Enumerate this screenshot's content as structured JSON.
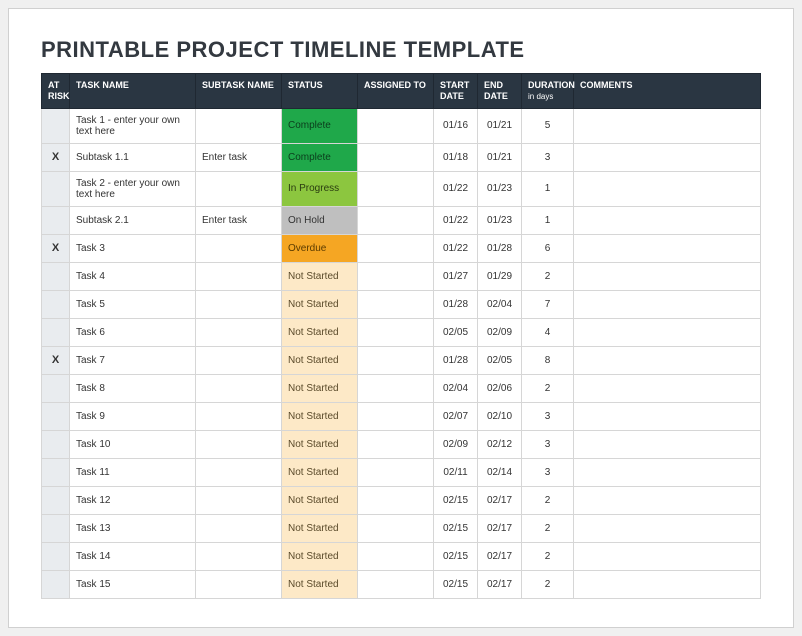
{
  "title": "PRINTABLE PROJECT TIMELINE TEMPLATE",
  "headers": {
    "at_risk": "AT RISK",
    "task_name": "TASK NAME",
    "subtask_name": "SUBTASK NAME",
    "status": "STATUS",
    "assigned_to": "ASSIGNED TO",
    "start_date": "START DATE",
    "end_date": "END DATE",
    "duration": "DURATION",
    "duration_sub": "in days",
    "comments": "COMMENTS"
  },
  "status_styles": {
    "Complete": "st-complete",
    "In Progress": "st-inprogress",
    "On Hold": "st-onhold",
    "Overdue": "st-overdue",
    "Not Started": "st-notstarted"
  },
  "rows": [
    {
      "at_risk": "",
      "task": "Task 1 - enter your own text here",
      "subtask": "",
      "status": "Complete",
      "assigned": "",
      "start": "01/16",
      "end": "01/21",
      "duration": "5",
      "comments": ""
    },
    {
      "at_risk": "X",
      "task": "Subtask 1.1",
      "subtask": "Enter task",
      "status": "Complete",
      "assigned": "",
      "start": "01/18",
      "end": "01/21",
      "duration": "3",
      "comments": ""
    },
    {
      "at_risk": "",
      "task": "Task 2 - enter your own text here",
      "subtask": "",
      "status": "In Progress",
      "assigned": "",
      "start": "01/22",
      "end": "01/23",
      "duration": "1",
      "comments": ""
    },
    {
      "at_risk": "",
      "task": "Subtask 2.1",
      "subtask": "Enter task",
      "status": "On Hold",
      "assigned": "",
      "start": "01/22",
      "end": "01/23",
      "duration": "1",
      "comments": ""
    },
    {
      "at_risk": "X",
      "task": "Task 3",
      "subtask": "",
      "status": "Overdue",
      "assigned": "",
      "start": "01/22",
      "end": "01/28",
      "duration": "6",
      "comments": ""
    },
    {
      "at_risk": "",
      "task": "Task 4",
      "subtask": "",
      "status": "Not Started",
      "assigned": "",
      "start": "01/27",
      "end": "01/29",
      "duration": "2",
      "comments": ""
    },
    {
      "at_risk": "",
      "task": "Task 5",
      "subtask": "",
      "status": "Not Started",
      "assigned": "",
      "start": "01/28",
      "end": "02/04",
      "duration": "7",
      "comments": ""
    },
    {
      "at_risk": "",
      "task": "Task 6",
      "subtask": "",
      "status": "Not Started",
      "assigned": "",
      "start": "02/05",
      "end": "02/09",
      "duration": "4",
      "comments": ""
    },
    {
      "at_risk": "X",
      "task": "Task 7",
      "subtask": "",
      "status": "Not Started",
      "assigned": "",
      "start": "01/28",
      "end": "02/05",
      "duration": "8",
      "comments": ""
    },
    {
      "at_risk": "",
      "task": "Task 8",
      "subtask": "",
      "status": "Not Started",
      "assigned": "",
      "start": "02/04",
      "end": "02/06",
      "duration": "2",
      "comments": ""
    },
    {
      "at_risk": "",
      "task": "Task 9",
      "subtask": "",
      "status": "Not Started",
      "assigned": "",
      "start": "02/07",
      "end": "02/10",
      "duration": "3",
      "comments": ""
    },
    {
      "at_risk": "",
      "task": "Task 10",
      "subtask": "",
      "status": "Not Started",
      "assigned": "",
      "start": "02/09",
      "end": "02/12",
      "duration": "3",
      "comments": ""
    },
    {
      "at_risk": "",
      "task": "Task 11",
      "subtask": "",
      "status": "Not Started",
      "assigned": "",
      "start": "02/11",
      "end": "02/14",
      "duration": "3",
      "comments": ""
    },
    {
      "at_risk": "",
      "task": "Task 12",
      "subtask": "",
      "status": "Not Started",
      "assigned": "",
      "start": "02/15",
      "end": "02/17",
      "duration": "2",
      "comments": ""
    },
    {
      "at_risk": "",
      "task": "Task 13",
      "subtask": "",
      "status": "Not Started",
      "assigned": "",
      "start": "02/15",
      "end": "02/17",
      "duration": "2",
      "comments": ""
    },
    {
      "at_risk": "",
      "task": "Task 14",
      "subtask": "",
      "status": "Not Started",
      "assigned": "",
      "start": "02/15",
      "end": "02/17",
      "duration": "2",
      "comments": ""
    },
    {
      "at_risk": "",
      "task": "Task 15",
      "subtask": "",
      "status": "Not Started",
      "assigned": "",
      "start": "02/15",
      "end": "02/17",
      "duration": "2",
      "comments": ""
    }
  ]
}
